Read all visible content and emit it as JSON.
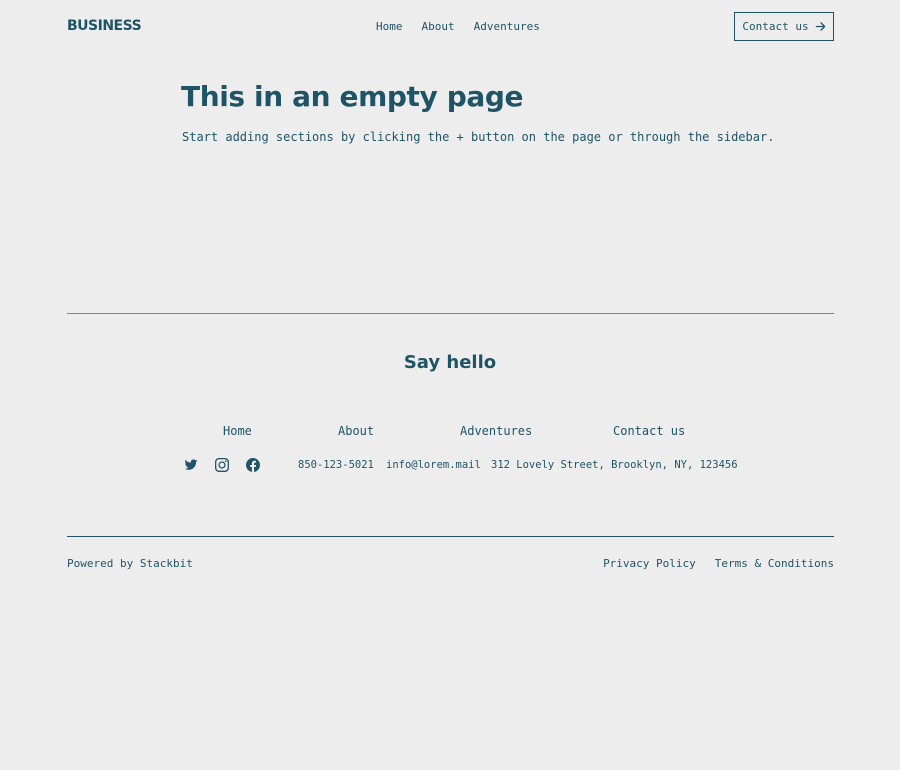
{
  "header": {
    "logo": "BUSINESS",
    "nav": [
      "Home",
      "About",
      "Adventures"
    ],
    "contact_label": "Contact us"
  },
  "hero": {
    "title": "This in an empty page",
    "subtitle": "Start adding sections by clicking the + button on the page or through the sidebar."
  },
  "footer": {
    "heading": "Say hello",
    "nav": [
      "Home",
      "About",
      "Adventures",
      "Contact us"
    ],
    "social": [
      "twitter-icon",
      "instagram-icon",
      "facebook-icon"
    ],
    "phone": "850-123-5021",
    "email": "info@lorem.mail",
    "address": "312 Lovely Street, Brooklyn, NY, 123456",
    "powered_by": "Powered by Stackbit",
    "legal": [
      "Privacy Policy",
      "Terms & Conditions"
    ]
  },
  "colors": {
    "background": "#ededed",
    "primary": "#1f5466"
  }
}
